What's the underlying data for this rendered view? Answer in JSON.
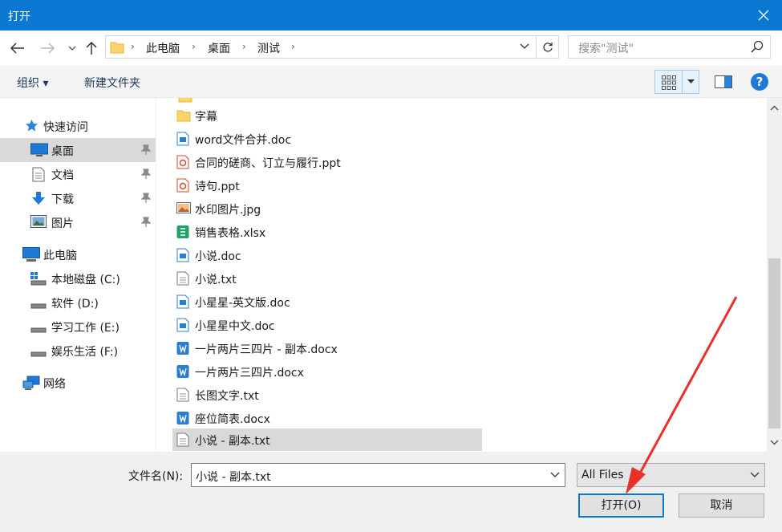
{
  "window": {
    "title": "打开",
    "close_icon": "close-icon"
  },
  "nav": {
    "back_icon": "back-arrow-icon",
    "forward_icon": "forward-arrow-icon",
    "recent_icon": "chevron-down-icon",
    "up_icon": "up-arrow-icon",
    "breadcrumb": [
      "此电脑",
      "桌面",
      "测试"
    ],
    "search_placeholder": "搜索\"测试\""
  },
  "toolbar": {
    "organize": "组织 ▾",
    "new_folder": "新建文件夹"
  },
  "sidebar": {
    "items": [
      {
        "label": "快速访问",
        "icon": "star-icon",
        "pinned": false,
        "selected": false
      },
      {
        "label": "桌面",
        "icon": "desktop-icon",
        "pinned": true,
        "selected": true
      },
      {
        "label": "文档",
        "icon": "document-icon",
        "pinned": true,
        "selected": false
      },
      {
        "label": "下载",
        "icon": "download-icon",
        "pinned": true,
        "selected": false
      },
      {
        "label": "图片",
        "icon": "pictures-icon",
        "pinned": true,
        "selected": false
      },
      {
        "label": "此电脑",
        "icon": "computer-icon",
        "pinned": false,
        "selected": false
      },
      {
        "label": "本地磁盘 (C:)",
        "icon": "system-drive-icon",
        "pinned": false,
        "selected": false
      },
      {
        "label": "软件 (D:)",
        "icon": "drive-icon",
        "pinned": false,
        "selected": false
      },
      {
        "label": "学习工作 (E:)",
        "icon": "drive-icon",
        "pinned": false,
        "selected": false
      },
      {
        "label": "娱乐生活 (F:)",
        "icon": "drive-icon",
        "pinned": false,
        "selected": false
      },
      {
        "label": "网络",
        "icon": "network-icon",
        "pinned": false,
        "selected": false
      }
    ]
  },
  "files": [
    {
      "name": "字幕",
      "type": "folder"
    },
    {
      "name": "word文件合并.doc",
      "type": "doc"
    },
    {
      "name": "合同的磋商、订立与履行.ppt",
      "type": "ppt"
    },
    {
      "name": "诗句.ppt",
      "type": "ppt"
    },
    {
      "name": "水印图片.jpg",
      "type": "jpg"
    },
    {
      "name": "销售表格.xlsx",
      "type": "xlsx"
    },
    {
      "name": "小说.doc",
      "type": "doc"
    },
    {
      "name": "小说.txt",
      "type": "txt"
    },
    {
      "name": "小星星-英文版.doc",
      "type": "doc"
    },
    {
      "name": "小星星中文.doc",
      "type": "doc"
    },
    {
      "name": "一片两片三四片 - 副本.docx",
      "type": "docx"
    },
    {
      "name": "一片两片三四片.docx",
      "type": "docx"
    },
    {
      "name": "长图文字.txt",
      "type": "txt"
    },
    {
      "name": "座位简表.docx",
      "type": "docx"
    },
    {
      "name": "小说 - 副本.txt",
      "type": "txt",
      "selected": true
    }
  ],
  "bottom": {
    "filename_label": "文件名(N):",
    "filename_value": "小说 - 副本.txt",
    "filter_value": "All Files",
    "open_label": "打开(O)",
    "cancel_label": "取消"
  },
  "colors": {
    "titlebar": "#0b78d4",
    "selection": "#d9d9d9",
    "annotation": "#e8302a"
  }
}
